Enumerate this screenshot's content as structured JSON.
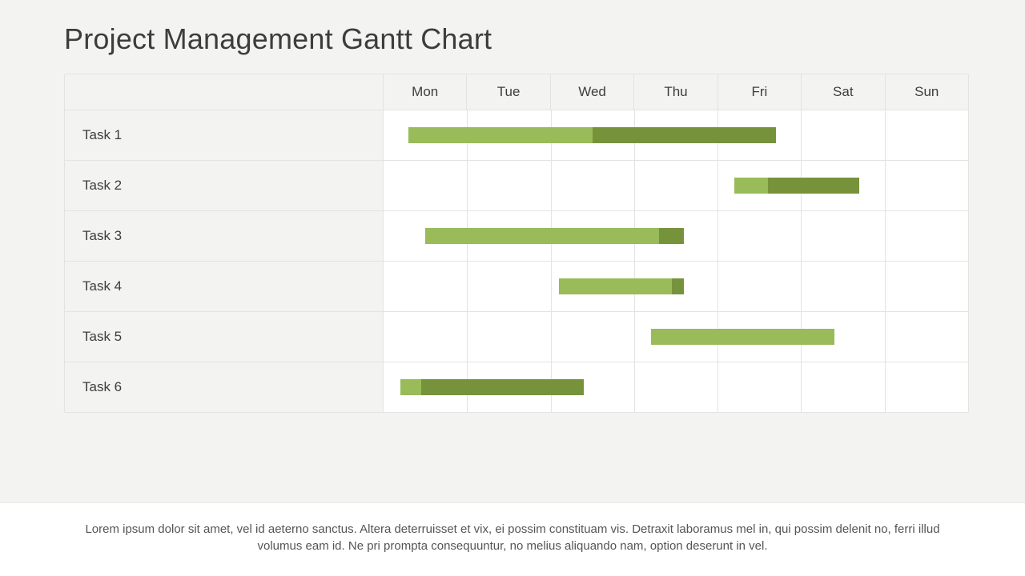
{
  "title": "Project Management Gantt Chart",
  "footer_text": "Lorem ipsum dolor sit amet, vel id aeterno sanctus. Altera deterruisset et vix, ei possim constituam vis. Detraxit laboramus mel in, qui possim delenit no, ferri illud volumus eam id. Ne pri prompta consequuntur, no melius aliquando nam, option deserunt in vel.",
  "colors": {
    "bar_light": "#99bb59",
    "bar_dark": "#76933c"
  },
  "chart_data": {
    "type": "bar",
    "orientation": "horizontal-gantt",
    "categories": [
      "Mon",
      "Tue",
      "Wed",
      "Thu",
      "Fri",
      "Sat",
      "Sun"
    ],
    "x_unit": "days (0 = Mon start, 7 = Sun end)",
    "tasks": [
      {
        "name": "Task 1",
        "start": 0.3,
        "end": 4.7,
        "split": 2.5
      },
      {
        "name": "Task 2",
        "start": 4.2,
        "end": 5.7,
        "split": 4.6
      },
      {
        "name": "Task 3",
        "start": 0.5,
        "end": 3.6,
        "split": 3.3
      },
      {
        "name": "Task 4",
        "start": 2.1,
        "end": 3.6,
        "split": 3.45
      },
      {
        "name": "Task 5",
        "start": 3.2,
        "end": 5.4,
        "split": 5.4
      },
      {
        "name": "Task 6",
        "start": 0.2,
        "end": 2.4,
        "split": 0.45
      }
    ],
    "note": "Each bar has a lighter-green segment from start→split and darker-green from split→end.",
    "title": "Project Management Gantt Chart"
  }
}
